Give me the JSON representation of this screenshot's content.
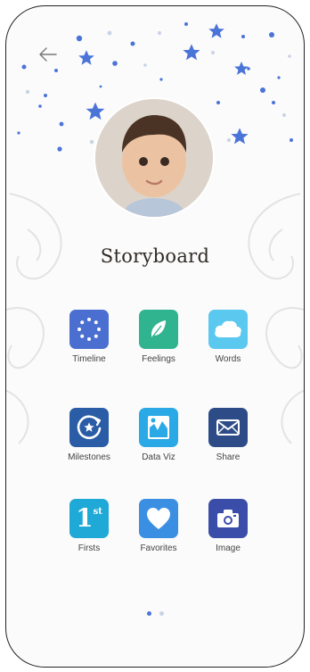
{
  "page": {
    "title": "Storyboard"
  },
  "colors": {
    "timeline": "#4a6fd1",
    "feelings": "#30b38f",
    "words": "#5bc8f0",
    "milestones": "#2a5da5",
    "dataviz": "#2aa9e6",
    "share": "#2d4b86",
    "firsts": "#1ea9d6",
    "favorites": "#3b8fe3",
    "image": "#3a4da8",
    "star": "#4b74d9",
    "dot_active": "#4b74d9",
    "dot_inactive": "#c9d3e6"
  },
  "menu": [
    {
      "label": "Timeline",
      "icon": "timeline-ring-icon"
    },
    {
      "label": "Feelings",
      "icon": "feather-icon"
    },
    {
      "label": "Words",
      "icon": "cloud-icon"
    },
    {
      "label": "Milestones",
      "icon": "milestone-star-icon"
    },
    {
      "label": "Data Viz",
      "icon": "chart-icon"
    },
    {
      "label": "Share",
      "icon": "envelope-icon"
    },
    {
      "label": "Firsts",
      "icon": "first-badge-icon"
    },
    {
      "label": "Favorites",
      "icon": "heart-icon"
    },
    {
      "label": "Image",
      "icon": "camera-icon"
    }
  ],
  "firsts_badge": {
    "number": "1",
    "suffix": "st"
  },
  "pagination": {
    "current": 1,
    "total": 2
  }
}
